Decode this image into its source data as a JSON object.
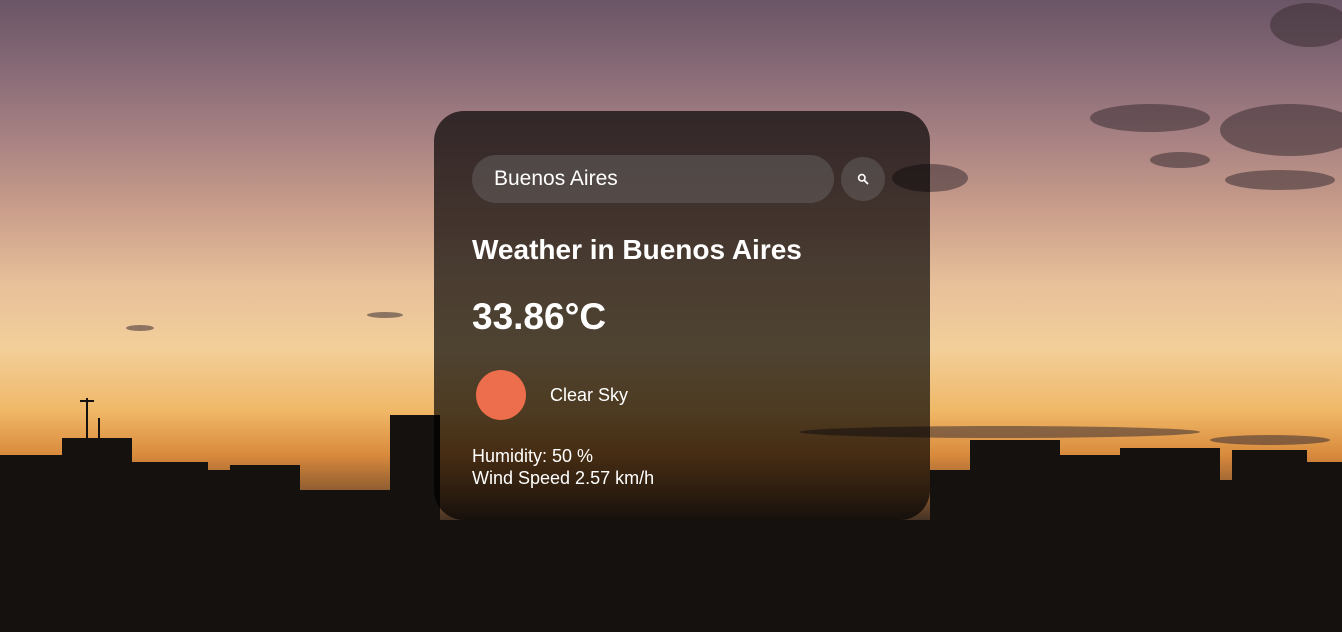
{
  "search": {
    "value": "Buenos Aires",
    "button_icon": "search-icon"
  },
  "weather": {
    "title": "Weather in Buenos Aires",
    "temperature": "33.86°C",
    "description": "Clear Sky",
    "humidity": "Humidity: 50 %",
    "wind": "Wind Speed 2.57 km/h",
    "icon_name": "clear-sky-icon"
  },
  "colors": {
    "card_background": "rgba(0,0,0,0.68)",
    "sun_icon": "#ec6e4c",
    "text": "#ffffff"
  }
}
